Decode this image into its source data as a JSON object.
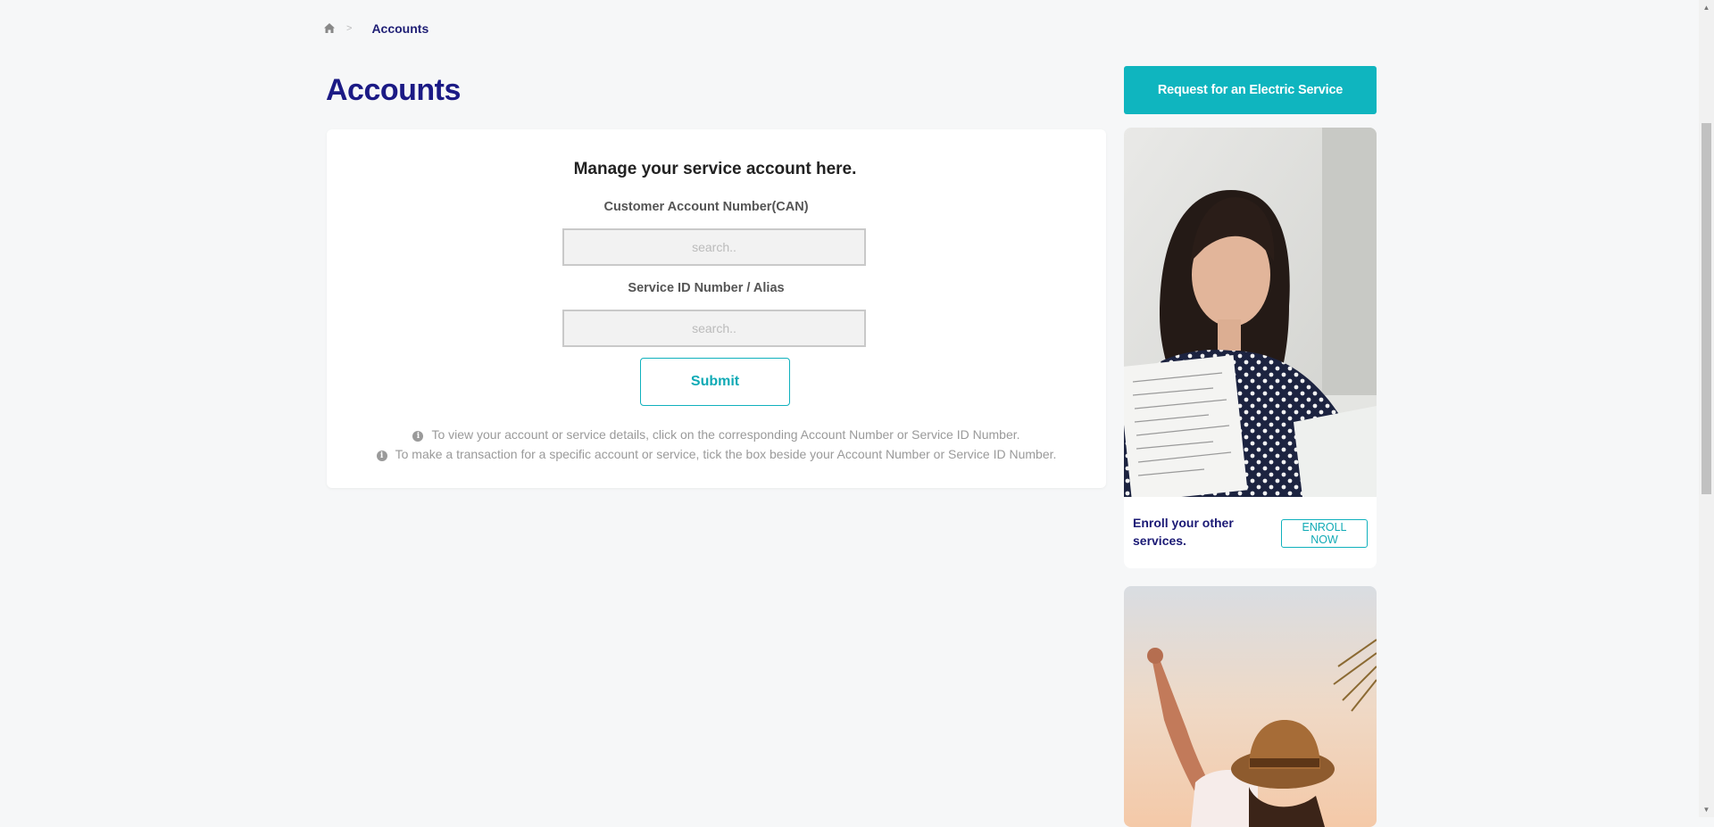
{
  "breadcrumb": {
    "home_icon": "home-icon",
    "separator": ">",
    "current": "Accounts"
  },
  "page": {
    "title": "Accounts"
  },
  "card": {
    "heading": "Manage your service account here.",
    "can_label": "Customer Account Number(CAN)",
    "can_placeholder": "search..",
    "can_value": "",
    "sid_label": "Service ID Number / Alias",
    "sid_placeholder": "search..",
    "sid_value": "",
    "submit_label": "Submit",
    "info_icon": "info-icon",
    "info_1": "To view your account or service details, click on the corresponding Account Number or Service ID Number.",
    "info_2": "To make a transaction for a specific account or service, tick the box beside your Account Number or Service ID Number."
  },
  "sidebar": {
    "cta_label": "Request for an Electric Service",
    "promo": {
      "text": "Enroll your other services.",
      "button": "ENROLL NOW"
    }
  },
  "colors": {
    "accent": "#0fb5bf",
    "title": "#1b1a85",
    "background": "#f6f7f8"
  }
}
